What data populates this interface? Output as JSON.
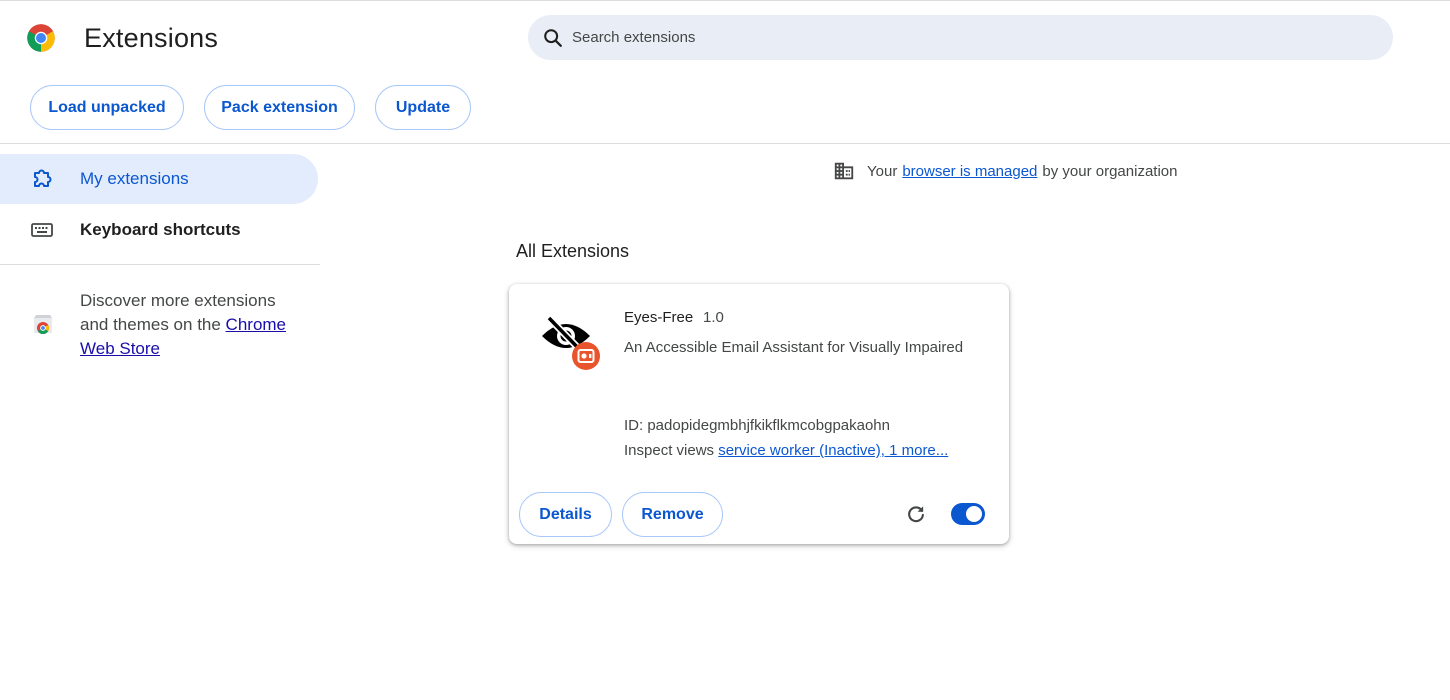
{
  "header": {
    "title": "Extensions",
    "search_placeholder": "Search extensions",
    "buttons": {
      "load_unpacked": "Load unpacked",
      "pack_extension": "Pack extension",
      "update": "Update"
    }
  },
  "sidebar": {
    "items": [
      {
        "label": "My extensions",
        "icon": "puzzle-icon",
        "selected": true
      },
      {
        "label": "Keyboard shortcuts",
        "icon": "keyboard-icon",
        "selected": false
      }
    ],
    "discover": {
      "text_before": "Discover more extensions and themes on the ",
      "link": "Chrome Web Store"
    }
  },
  "main": {
    "managed": {
      "prefix": "Your",
      "link": "browser is managed",
      "suffix": "by your organization"
    },
    "section_title": "All Extensions"
  },
  "extension": {
    "name": "Eyes-Free",
    "version": "1.0",
    "description": "An Accessible Email Assistant for Visually Impaired",
    "id_text": "ID: padopidegmbhjfkikflkmcobgpakaohn",
    "inspect_label": "Inspect views",
    "inspect_link": "service worker (Inactive), 1 more...",
    "buttons": {
      "details": "Details",
      "remove": "Remove"
    },
    "enabled": true
  },
  "colors": {
    "accent": "#0b57d0",
    "selected_bg": "#e3ecfd",
    "search_bg": "#e9eef6",
    "button_border": "#a8c7fa",
    "badge": "#e8552d"
  }
}
